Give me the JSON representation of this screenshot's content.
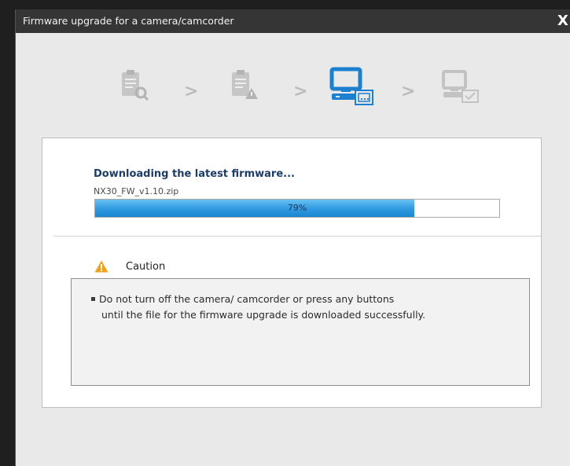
{
  "window": {
    "title": "Firmware upgrade for a camera/camcorder",
    "close_symbol": "X"
  },
  "steps": [
    {
      "icon": "document-search-icon",
      "state": "done"
    },
    {
      "icon": "document-warning-icon",
      "state": "done"
    },
    {
      "icon": "computer-camera-transfer-icon",
      "state": "active"
    },
    {
      "icon": "computer-check-icon",
      "state": "pending"
    }
  ],
  "step_separator": ">",
  "download": {
    "title": "Downloading the latest firmware...",
    "filename": "NX30_FW_v1.10.zip",
    "progress_label": "79%",
    "progress_fraction": 0.79
  },
  "caution": {
    "label": "Caution",
    "icon": "warning-triangle-icon",
    "message_line1": "Do not turn off the camera/ camcorder or press any buttons",
    "message_line2": "until the file for the firmware upgrade is downloaded successfully."
  },
  "colors": {
    "titlebar": "#353535",
    "window_bg": "#e9e9e9",
    "progress_fill": "#2f98df",
    "step_active": "#1c7fd0",
    "step_inactive": "#c3c3c3",
    "caution": "#f0a21a"
  }
}
